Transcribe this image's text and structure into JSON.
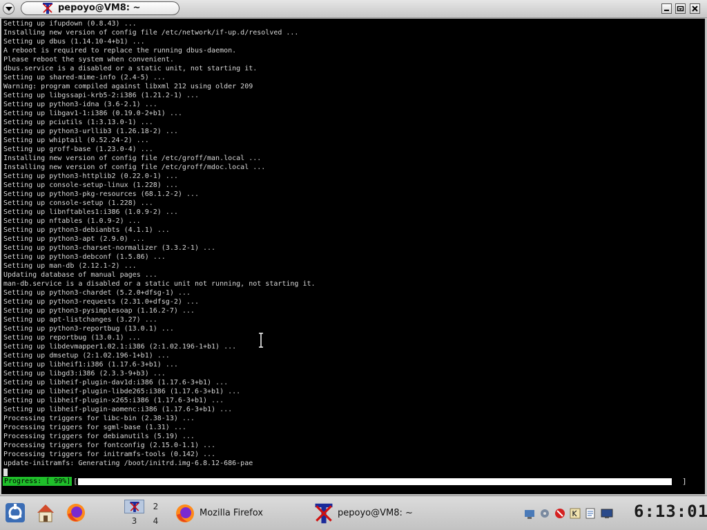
{
  "window": {
    "title": "pepoyo@VM8: ~"
  },
  "terminal": {
    "lines": [
      "Setting up ifupdown (0.8.43) ...",
      "Installing new version of config file /etc/network/if-up.d/resolved ...",
      "Setting up dbus (1.14.10-4+b1) ...",
      "A reboot is required to replace the running dbus-daemon.",
      "Please reboot the system when convenient.",
      "dbus.service is a disabled or a static unit, not starting it.",
      "Setting up shared-mime-info (2.4-5) ...",
      "Warning: program compiled against libxml 212 using older 209",
      "Setting up libgssapi-krb5-2:i386 (1.21.2-1) ...",
      "Setting up python3-idna (3.6-2.1) ...",
      "Setting up libgav1-1:i386 (0.19.0-2+b1) ...",
      "Setting up pciutils (1:3.13.0-1) ...",
      "Setting up python3-urllib3 (1.26.18-2) ...",
      "Setting up whiptail (0.52.24-2) ...",
      "Setting up groff-base (1.23.0-4) ...",
      "Installing new version of config file /etc/groff/man.local ...",
      "Installing new version of config file /etc/groff/mdoc.local ...",
      "Setting up python3-httplib2 (0.22.0-1) ...",
      "Setting up console-setup-linux (1.228) ...",
      "Setting up python3-pkg-resources (68.1.2-2) ...",
      "Setting up console-setup (1.228) ...",
      "Setting up libnftables1:i386 (1.0.9-2) ...",
      "Setting up nftables (1.0.9-2) ...",
      "Setting up python3-debianbts (4.1.1) ...",
      "Setting up python3-apt (2.9.0) ...",
      "Setting up python3-charset-normalizer (3.3.2-1) ...",
      "Setting up python3-debconf (1.5.86) ...",
      "Setting up man-db (2.12.1-2) ...",
      "Updating database of manual pages ...",
      "man-db.service is a disabled or a static unit not running, not starting it.",
      "Setting up python3-chardet (5.2.0+dfsg-1) ...",
      "Setting up python3-requests (2.31.0+dfsg-2) ...",
      "Setting up python3-pysimplesoap (1.16.2-7) ...",
      "Setting up apt-listchanges (3.27) ...",
      "Setting up python3-reportbug (13.0.1) ...",
      "Setting up reportbug (13.0.1) ...",
      "Setting up libdevmapper1.02.1:i386 (2:1.02.196-1+b1) ...",
      "Setting up dmsetup (2:1.02.196-1+b1) ...",
      "Setting up libheif1:i386 (1.17.6-3+b1) ...",
      "Setting up libgd3:i386 (2.3.3-9+b3) ...",
      "Setting up libheif-plugin-dav1d:i386 (1.17.6-3+b1) ...",
      "Setting up libheif-plugin-libde265:i386 (1.17.6-3+b1) ...",
      "Setting up libheif-plugin-x265:i386 (1.17.6-3+b1) ...",
      "Setting up libheif-plugin-aomenc:i386 (1.17.6-3+b1) ...",
      "Processing triggers for libc-bin (2.38-13) ...",
      "Processing triggers for sgml-base (1.31) ...",
      "Processing triggers for debianutils (5.19) ...",
      "Processing triggers for fontconfig (2.15.0-1.1) ...",
      "Processing triggers for initramfs-tools (0.142) ...",
      "update-initramfs: Generating /boot/initrd.img-6.8.12-686-pae"
    ],
    "progress_label": "Progress: [ 99%]",
    "progress_open": "[",
    "progress_close": "]",
    "progress_fraction": 0.99
  },
  "taskbar": {
    "pager": [
      "1",
      "2",
      "3",
      "4"
    ],
    "tasks": [
      {
        "label": "Mozilla Firefox",
        "icon": "firefox-icon"
      },
      {
        "label": "pepoyo@VM8: ~",
        "icon": "terminal-icon"
      }
    ],
    "clock": "6:13:01"
  },
  "colors": {
    "terminal_bg": "#000000",
    "terminal_fg": "#d9d9d9",
    "progress_green": "#1fbf2a"
  }
}
